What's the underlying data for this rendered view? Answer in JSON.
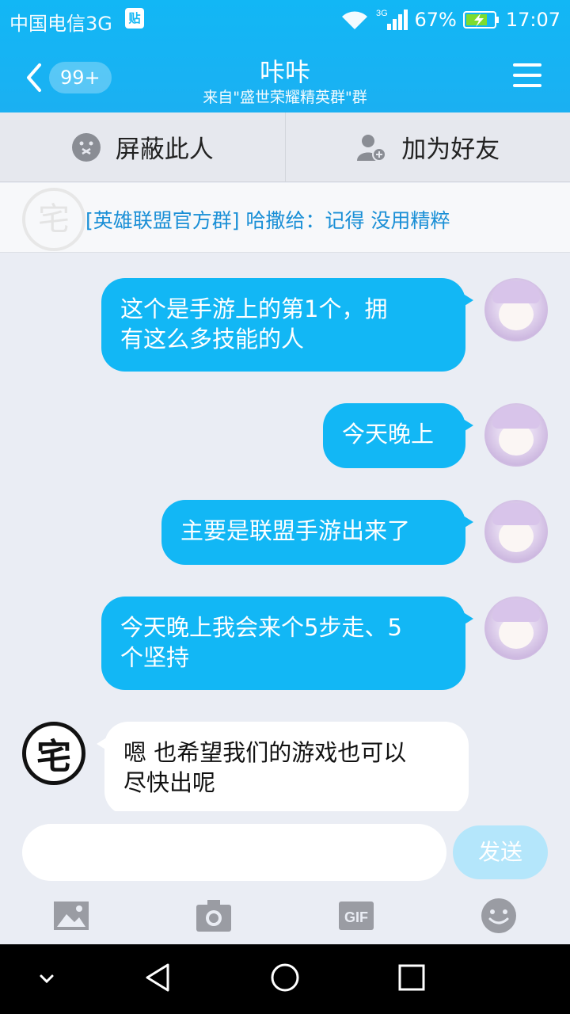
{
  "status_bar": {
    "carrier": "中国电信3G",
    "network": "3G",
    "battery": "67%",
    "time": "17:07"
  },
  "header": {
    "back_badge": "99+",
    "title": "咔咔",
    "subtitle": "来自\"盛世荣耀精英群\"群"
  },
  "actions": {
    "block_label": "屏蔽此人",
    "add_friend_label": "加为好友"
  },
  "notice": {
    "ghost_char": "宅",
    "text": "[英雄联盟官方群] 哈撒给：记得 没用精粹"
  },
  "messages": [
    {
      "side": "out",
      "line1": "这个是手游上的第1个，拥",
      "line2": "有这么多技能的人"
    },
    {
      "side": "out",
      "line1": "今天晚上"
    },
    {
      "side": "out",
      "line1": "主要是联盟手游出来了"
    },
    {
      "side": "out",
      "line1": "今天晚上我会来个5步走、5",
      "line2": "个坚持"
    },
    {
      "side": "in",
      "line1": "嗯 也希望我们的游戏也可以",
      "line2": "尽快出呢",
      "avatar_char": "宅"
    }
  ],
  "composer": {
    "send_label": "发送",
    "gif_label": "GIF"
  },
  "colors": {
    "accent": "#12b7f5",
    "bubble_out": "#12b7f5",
    "bubble_in": "#ffffff",
    "background": "#eaedf4"
  }
}
